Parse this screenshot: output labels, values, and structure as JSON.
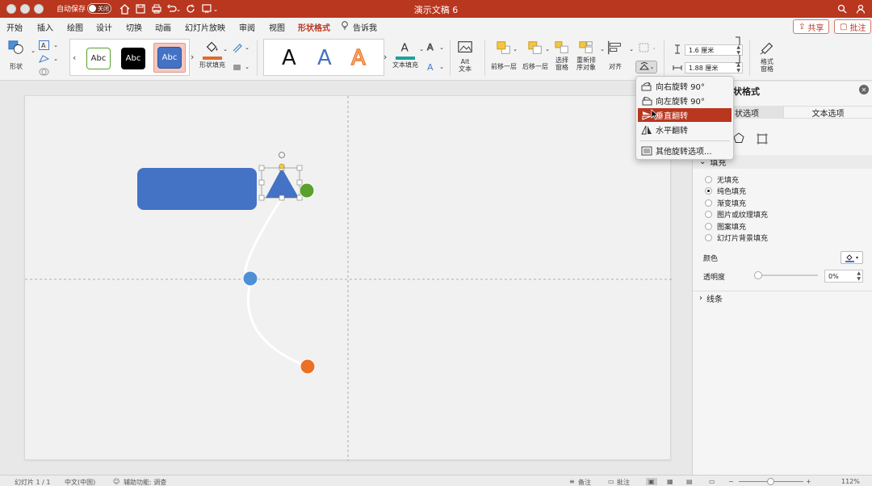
{
  "window": {
    "title": "演示文稿 6",
    "autosave_label": "自动保存",
    "autosave_state": "关闭"
  },
  "menu_tabs": [
    {
      "label": "开始"
    },
    {
      "label": "插入"
    },
    {
      "label": "绘图"
    },
    {
      "label": "设计"
    },
    {
      "label": "切换"
    },
    {
      "label": "动画"
    },
    {
      "label": "幻灯片放映"
    },
    {
      "label": "审阅"
    },
    {
      "label": "视图"
    },
    {
      "label": "形状格式",
      "active": true
    },
    {
      "label": "告诉我"
    }
  ],
  "top_buttons": {
    "share": "共享",
    "comment": "批注"
  },
  "ribbon": {
    "shape_label": "形状",
    "shape_fill_label": "形状填充",
    "shape_styles": [
      "Abc",
      "Abc",
      "Abc"
    ],
    "text_fill_label": "文本填充",
    "alt_text_label": "Alt\n文本",
    "bring_forward_label": "前移一层",
    "send_backward_label": "后移一层",
    "selection_pane_label": "选择\n窗格",
    "reorder_label": "重新排\n序对象",
    "align_label": "对齐",
    "height_value": "1.6 厘米",
    "width_value": "1.88 厘米",
    "format_pane_label": "格式\n窗格",
    "accent_color": "#b9361f",
    "fill_color_swatch": "#e06b2e"
  },
  "rotate_menu": {
    "items": [
      {
        "label": "向右旋转 90°"
      },
      {
        "label": "向左旋转 90°"
      },
      {
        "label": "垂直翻转",
        "highlighted": true
      },
      {
        "label": "水平翻转"
      },
      {
        "label": "其他旋转选项..."
      }
    ]
  },
  "format_pane": {
    "title": "设置形状格式",
    "title_visible": "状格式",
    "tab_shape": "状选项",
    "tab_text": "文本选项",
    "fill_section": "填充",
    "fill_options": [
      {
        "label": "无填充",
        "selected": false
      },
      {
        "label": "纯色填充",
        "selected": true
      },
      {
        "label": "渐变填充",
        "selected": false
      },
      {
        "label": "图片或纹理填充",
        "selected": false
      },
      {
        "label": "图案填充",
        "selected": false
      },
      {
        "label": "幻灯片背景填充",
        "selected": false
      }
    ],
    "color_label": "颜色",
    "transparency_label": "透明度",
    "transparency_value": "0%",
    "line_section": "线条"
  },
  "slide": {
    "rectangle_color": "#4472c4",
    "triangle_color": "#4472c4",
    "green_dot_color": "#5aa02c",
    "blue_dot_color": "#4f8fd6",
    "orange_dot_color": "#ec7124"
  },
  "statusbar": {
    "slide_info": "幻灯片 1 / 1",
    "language": "中文(中国)",
    "accessibility": "辅助功能: 调查",
    "notes": "备注",
    "comments": "批注",
    "zoom": "112%"
  }
}
